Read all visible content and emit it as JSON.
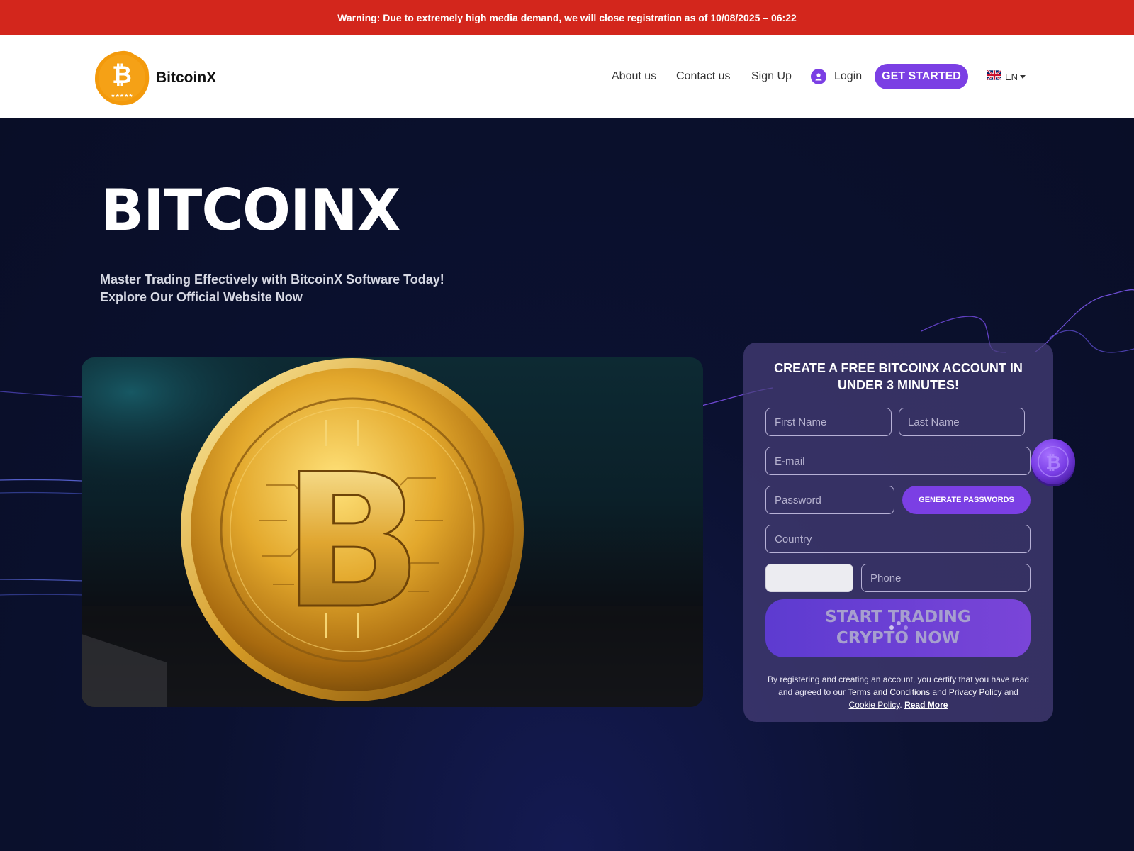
{
  "warning": {
    "text": "Warning: Due to extremely high media demand, we will close registration as of 10/08/2025 – 06:22"
  },
  "header": {
    "brand": "BitcoinX",
    "nav": {
      "about": "About us",
      "contact": "Contact us",
      "signup": "Sign Up",
      "login": "Login",
      "get_started": "GET STARTED",
      "language": "EN"
    }
  },
  "hero": {
    "title": "BITCOINX",
    "subtitle_line1": "Master Trading Effectively with BitcoinX Software Today!",
    "subtitle_line2": "Explore Our Official Website Now"
  },
  "form": {
    "title": "CREATE A FREE BITCOINX ACCOUNT IN UNDER 3 MINUTES!",
    "first_name_placeholder": "First Name",
    "last_name_placeholder": "Last Name",
    "email_placeholder": "E-mail",
    "password_placeholder": "Password",
    "generate_label": "GENERATE PASSWORDS",
    "country_placeholder": "Country",
    "phone_placeholder": "Phone",
    "submit_label": "START TRADING CRYPTO NOW",
    "legal": {
      "prefix": "By registering and creating an account, you certify that you have read and agreed to our",
      "terms": "Terms and Conditions",
      "and1": "and",
      "privacy": "Privacy Policy",
      "and2": "and",
      "cookie": "Cookie Policy",
      "period": ".",
      "read_more": "Read More"
    }
  },
  "colors": {
    "warning_bg": "#d3261c",
    "accent": "#7b3fe4",
    "hero_bg": "#0a0f2a",
    "logo_orange": "#f39a0c"
  },
  "icons": {
    "logo": "bitcoin-badge-icon",
    "user": "user-icon",
    "flag": "uk-flag-icon",
    "coin": "bitcoin-coin-icon"
  }
}
